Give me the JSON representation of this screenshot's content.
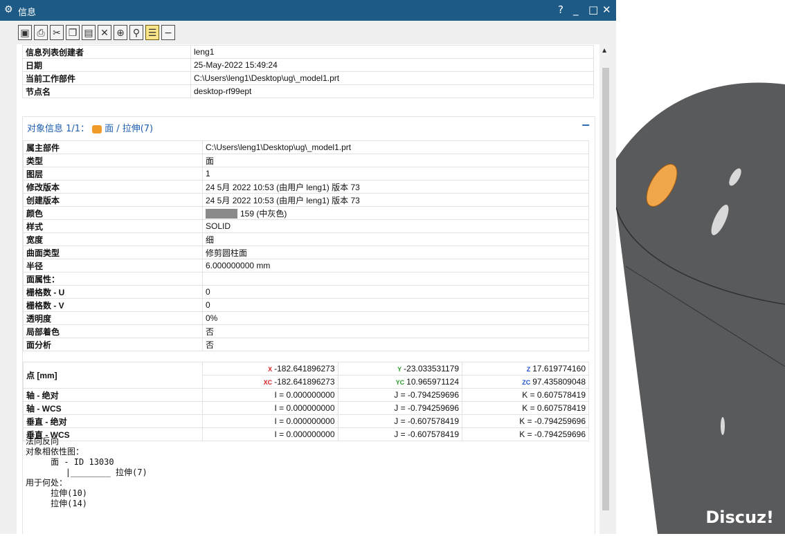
{
  "window": {
    "title": "信息",
    "help": "?",
    "minimize": "_",
    "maximize": "□",
    "close": "✕"
  },
  "toolbar": [
    "save-icon",
    "print-icon",
    "cut-icon",
    "copy-icon",
    "paste-icon",
    "delete-icon",
    "select-icon",
    "find-icon",
    "wrap-icon",
    "collapse-icon"
  ],
  "header": {
    "rows": [
      {
        "k": "信息列表创建者",
        "v": "leng1"
      },
      {
        "k": "日期",
        "v": "25-May-2022 15:49:24"
      },
      {
        "k": "当前工作部件",
        "v": "C:\\Users\\leng1\\Desktop\\ug\\_model1.prt"
      },
      {
        "k": "节点名",
        "v": "desktop-rf99ept"
      }
    ]
  },
  "object": {
    "title_prefix": "对象信息 1/1：",
    "title_main": "面 / 拉伸(7)",
    "collapse": "−",
    "rows": [
      {
        "k": "属主部件",
        "v": "C:\\Users\\leng1\\Desktop\\ug\\_model1.prt"
      },
      {
        "k": "类型",
        "v": "面"
      },
      {
        "k": "图层",
        "v": "1"
      },
      {
        "k": "修改版本",
        "v": "24 5月 2022 10:53 (由用户 leng1) 版本 73"
      },
      {
        "k": "创建版本",
        "v": "24 5月 2022 10:53 (由用户 leng1) 版本 73"
      },
      {
        "k": "颜色",
        "v": "159 (中灰色)"
      },
      {
        "k": "样式",
        "v": "SOLID"
      },
      {
        "k": "宽度",
        "v": "细"
      },
      {
        "k": "曲面类型",
        "v": "修剪圆柱面"
      },
      {
        "k": "半径",
        "v": "6.000000000 mm"
      },
      {
        "k": "面属性：",
        "v": ""
      },
      {
        "k": "栅格数 - U",
        "v": "0"
      },
      {
        "k": "栅格数 - V",
        "v": "0"
      },
      {
        "k": "透明度",
        "v": "0%"
      },
      {
        "k": "局部着色",
        "v": "否"
      },
      {
        "k": "面分析",
        "v": "否"
      }
    ],
    "point": {
      "label": "点 [mm]",
      "abs": {
        "x": "-182.641896273",
        "y": "-23.033531179",
        "z": "17.619774160"
      },
      "wcs": {
        "x": "-182.641896273",
        "y": "10.965971124",
        "z": "97.435809048"
      },
      "axis_labels": {
        "x": "X",
        "y": "Y",
        "z": "Z",
        "xc": "XC",
        "yc": "YC",
        "zc": "ZC"
      }
    },
    "vectors": [
      {
        "k": "轴 - 绝对",
        "i": "I = 0.000000000",
        "j": "J = -0.794259696",
        "kk": "K = 0.607578419"
      },
      {
        "k": "轴 - WCS",
        "i": "I = 0.000000000",
        "j": "J = -0.794259696",
        "kk": "K = 0.607578419"
      },
      {
        "k": "垂直 - 绝对",
        "i": "I = 0.000000000",
        "j": "J = -0.607578419",
        "kk": "K = -0.794259696"
      },
      {
        "k": "垂直 - WCS",
        "i": "I = 0.000000000",
        "j": "J = -0.607578419",
        "kk": "K = -0.794259696"
      }
    ],
    "notes": {
      "l1": "法向反向",
      "l2": "对象相依性图：",
      "l3": "     面 - ID 13030",
      "l4": "        |________ 拉伸(7)",
      "l5": "用于何处：",
      "l6": "     拉伸(10)",
      "l7": "     拉伸(14)"
    }
  },
  "viewport": {
    "watermark": "Discuz!",
    "body_color": "#585a5c",
    "highlight_color": "#f0a64a"
  }
}
